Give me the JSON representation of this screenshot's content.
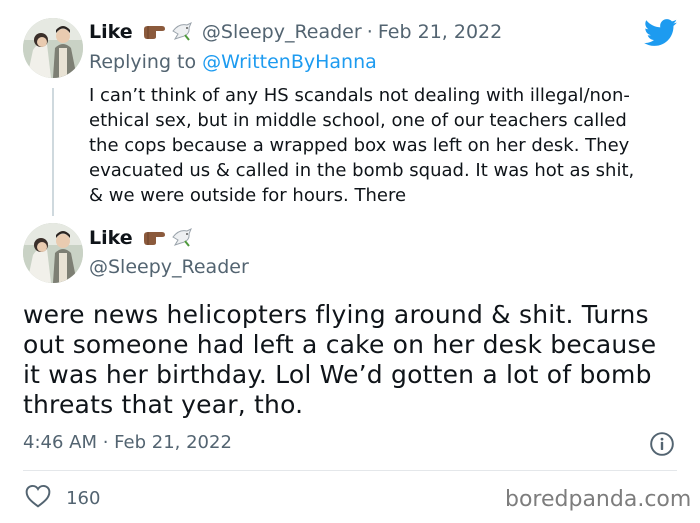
{
  "reply_tweet": {
    "display_name": "Like",
    "handle": "@Sleepy_Reader",
    "separator": "·",
    "date": "Feb 21, 2022",
    "replying_prefix": "Replying to",
    "replying_handle": "@WrittenByHanna",
    "lines": [
      "I can’t think of any HS scandals not dealing with illegal/non-",
      "ethical sex, but in middle school, one of our teachers called",
      "the cops because a wrapped box was left on her desk. They",
      "evacuated us & called in the bomb squad. It was hot as shit,",
      "& we were outside for hours. There"
    ]
  },
  "main_tweet": {
    "display_name": "Like",
    "handle": "@Sleepy_Reader",
    "lines": [
      "were news helicopters flying around & shit. Turns",
      "out someone had left a cake on her desk because",
      "it was her birthday. Lol We’d gotten a lot of bomb",
      "threats that year, tho."
    ],
    "time": "4:46 AM · Feb 21, 2022",
    "like_count": "160"
  },
  "icons": {
    "brand": "twitter-bird-icon",
    "info": "info-icon",
    "like": "heart-icon",
    "emoji_pointing": "backhand-index-pointing-right-icon",
    "emoji_dove": "dove-icon"
  },
  "colors": {
    "twitter_blue": "#1d9bf0",
    "text_primary": "#0f1419",
    "text_secondary": "#536471",
    "divider": "#e4e7ea"
  },
  "watermark": "boredpanda.com"
}
